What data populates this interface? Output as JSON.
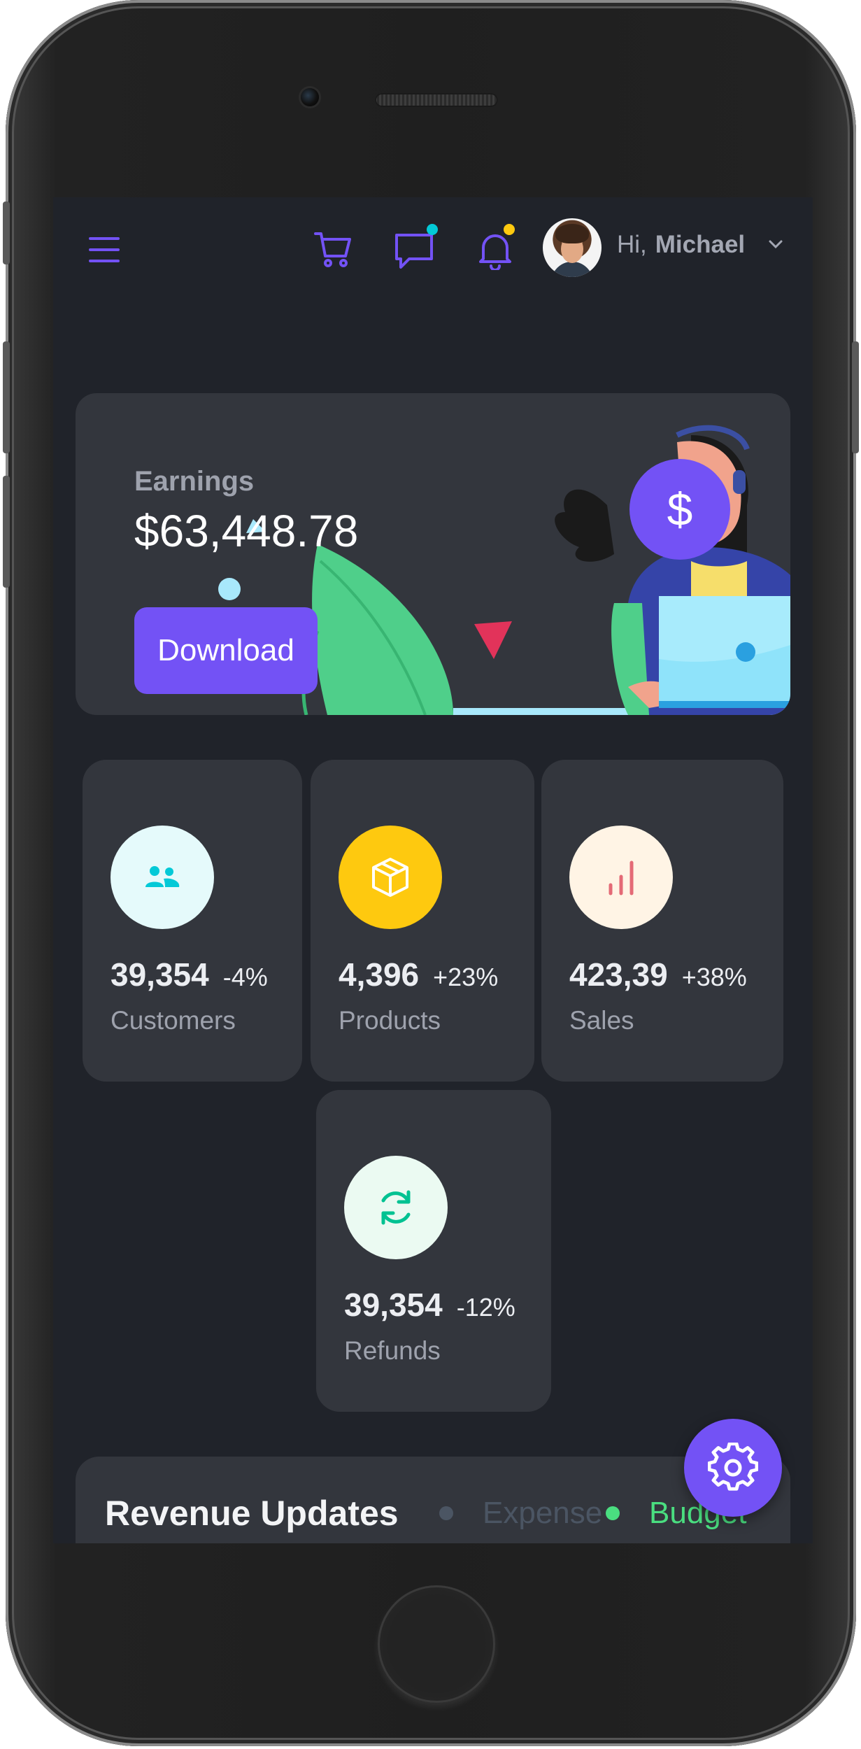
{
  "header": {
    "greeting": "Hi,",
    "user_name": "Michael"
  },
  "icons": {
    "menu": "hamburger-menu-icon",
    "cart": "cart-icon",
    "chat": "chat-icon",
    "notification": "bell-icon",
    "settings": "gear-icon"
  },
  "colors": {
    "accent": "#7352f5",
    "chat_badge": "#03c9d7",
    "notification_badge": "#fec90f",
    "screen_bg": "#20232a",
    "card_bg": "#33363d"
  },
  "earnings": {
    "label": "Earnings",
    "value": "$63,448.78",
    "download_label": "Download",
    "currency_symbol": "$"
  },
  "stats": [
    {
      "value": "39,354",
      "change": "-4%",
      "label": "Customers",
      "icon": "customers-icon",
      "icon_color": "#03c9d7",
      "icon_bg": "#e5fafb"
    },
    {
      "value": "4,396",
      "change": "+23%",
      "label": "Products",
      "icon": "box-icon",
      "icon_color": "#ffffff",
      "icon_bg": "#fec90f"
    },
    {
      "value": "423,39",
      "change": "+38%",
      "label": "Sales",
      "icon": "bar-chart-icon",
      "icon_color": "#e46a76",
      "icon_bg": "#fff4e5"
    },
    {
      "value": "39,354",
      "change": "-12%",
      "label": "Refunds",
      "icon": "refresh-icon",
      "icon_color": "#00c292",
      "icon_bg": "#ebfaf2"
    }
  ],
  "revenue": {
    "title": "Revenue Updates",
    "legend": [
      {
        "label": "Expense",
        "color": "#4b5563"
      },
      {
        "label": "Budget",
        "color": "#4ade80"
      }
    ]
  }
}
